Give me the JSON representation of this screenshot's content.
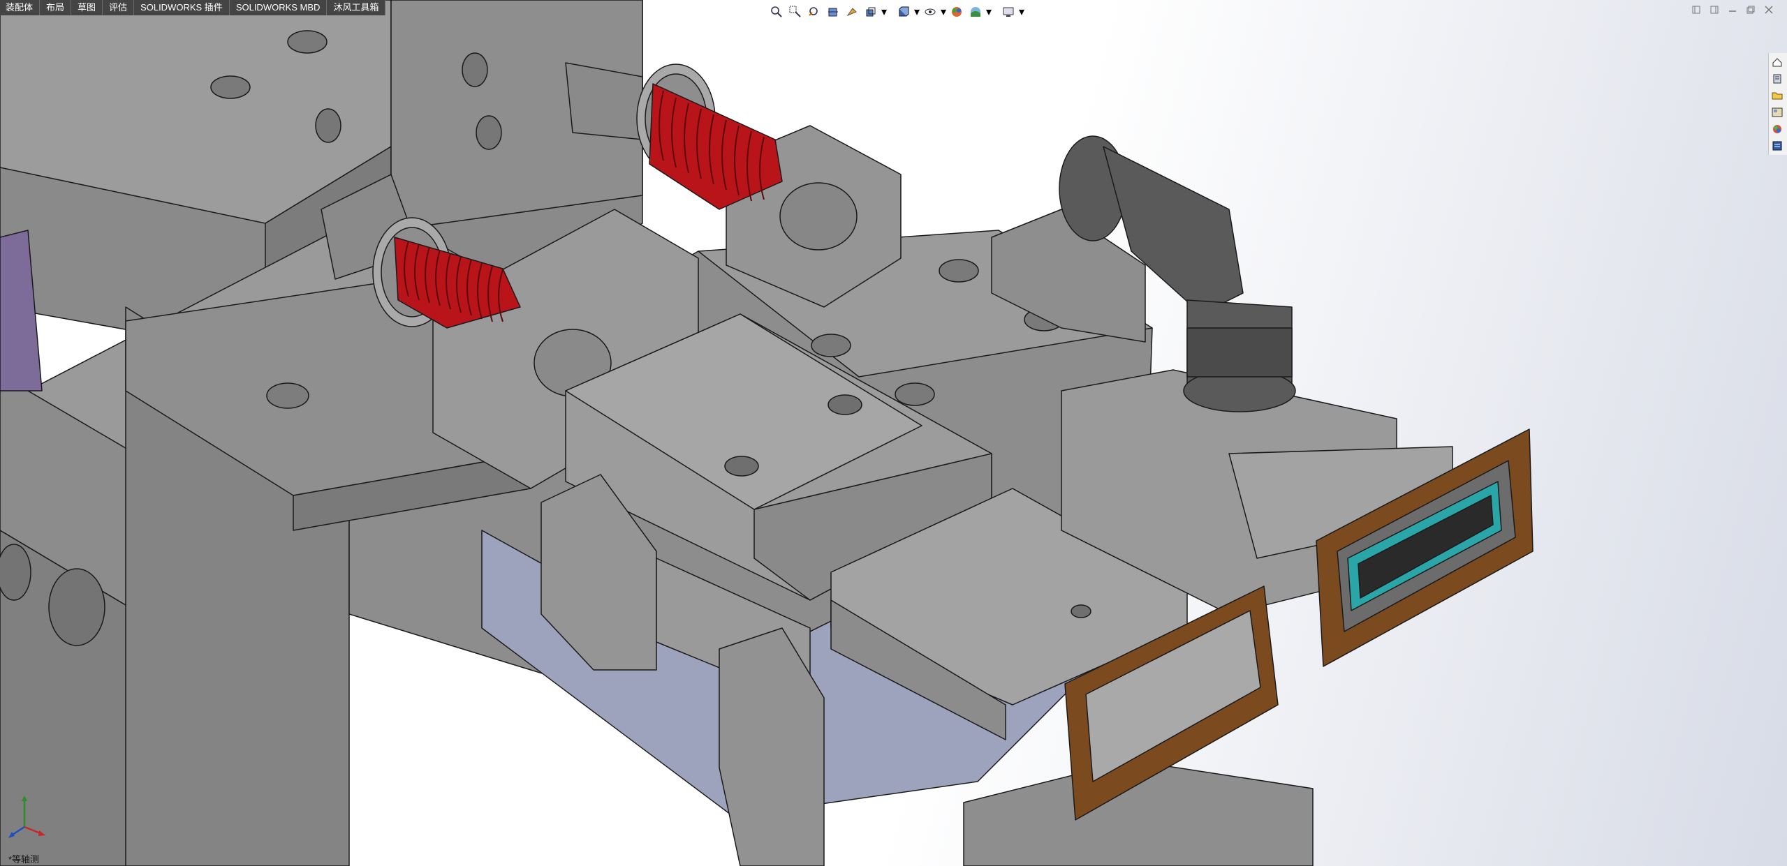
{
  "command_tabs": [
    {
      "label": "装配体"
    },
    {
      "label": "布局"
    },
    {
      "label": "草图"
    },
    {
      "label": "评估"
    },
    {
      "label": "SOLIDWORKS 插件"
    },
    {
      "label": "SOLIDWORKS MBD"
    },
    {
      "label": "沐风工具箱"
    }
  ],
  "view_label": "*等轴测",
  "heads_up_icons": [
    "zoom-to-fit-icon",
    "zoom-to-area-icon",
    "previous-view-icon",
    "section-view-icon",
    "dynamic-annotation-icon",
    "view-orientation-icon",
    "display-style-icon",
    "hide-show-items-icon",
    "edit-appearance-icon",
    "apply-scene-icon",
    "view-settings-icon"
  ],
  "task_pane_icons": [
    "solidworks-resources-icon",
    "design-library-icon",
    "file-explorer-icon",
    "view-palette-icon",
    "appearances-icon",
    "custom-properties-icon"
  ],
  "colors": {
    "part_gray": "#8f8f8f",
    "spring_red": "#c0141b",
    "gasket_brown": "#7b4a1f",
    "seal_teal": "#2aa6a9",
    "fitting_dark": "#5a5a5a"
  }
}
